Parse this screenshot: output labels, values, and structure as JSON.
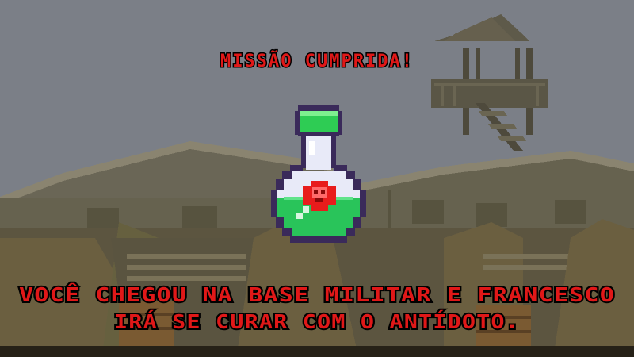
{
  "title": "MISSÃO CUMPRIDA!",
  "message_lines": [
    "VOCÊ CHEGOU NA BASE MILITAR E FRANCESCO",
    "IRÁ SE CURAR COM O ANTÍDOTO."
  ],
  "icons": {
    "item": "antidote-potion-icon",
    "item_symbol": "skull-icon"
  },
  "colors": {
    "sky": "#7b7f87",
    "text": "#e01818",
    "text_outline": "#000000",
    "potion_liquid": "#29c45a",
    "potion_cap": "#2ecc54",
    "bottle_glass": "#e8eaf8",
    "bottle_outline": "#3a2a5a",
    "label": "#e81c1c"
  }
}
